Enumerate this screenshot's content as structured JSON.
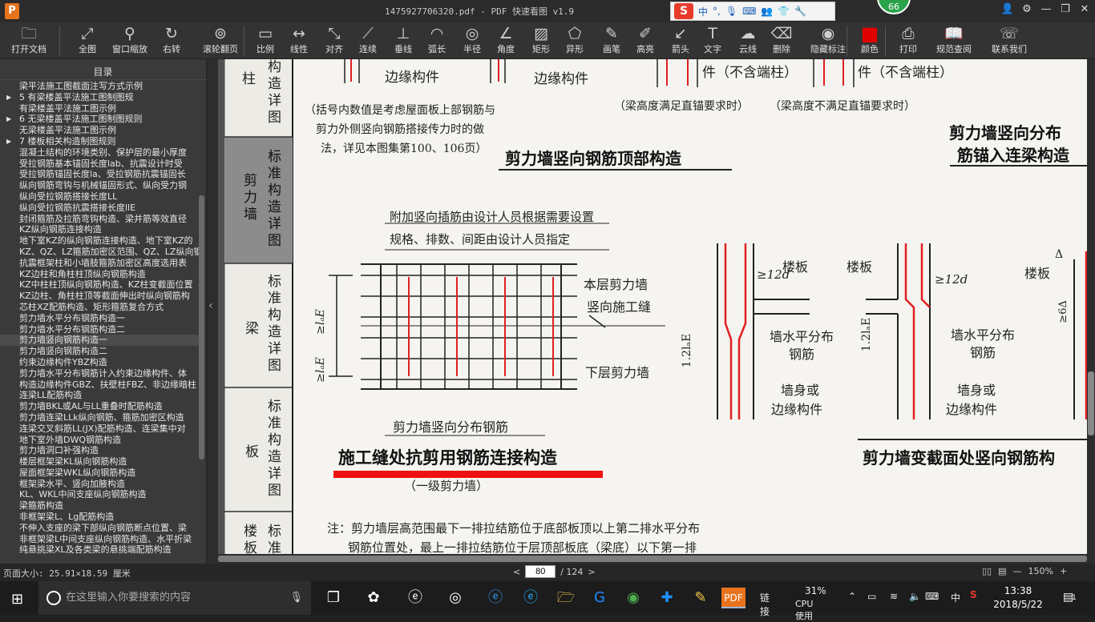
{
  "title_bar": {
    "app_logo": "P",
    "window_title": "1475927706320.pdf - PDF 快速看图 v1.9",
    "badge": "66",
    "ime": {
      "logo": "S",
      "lang": "中",
      "punct": "°,"
    },
    "buttons": {
      "user": "👤",
      "settings": "⚙",
      "min": "—",
      "max": "❐",
      "close": "✕"
    }
  },
  "toolbar": {
    "items": [
      {
        "label": "打开文档",
        "icon": "folder-icon",
        "glyph": "🗀"
      },
      {
        "label": "全图",
        "icon": "fit-all-icon",
        "glyph": "⤢"
      },
      {
        "label": "窗口缩放",
        "icon": "zoom-window-icon",
        "glyph": "⚲"
      },
      {
        "label": "右转",
        "icon": "rotate-right-icon",
        "glyph": "↻"
      },
      {
        "label": "滚轮翻页",
        "icon": "mouse-scroll-icon",
        "glyph": "⊚"
      },
      {
        "label": "比例",
        "icon": "scale-icon",
        "glyph": "▭"
      },
      {
        "label": "线性",
        "icon": "linear-measure-icon",
        "glyph": "↔"
      },
      {
        "label": "对齐",
        "icon": "aligned-measure-icon",
        "glyph": "⤡"
      },
      {
        "label": "连续",
        "icon": "continuous-measure-icon",
        "glyph": "⟋"
      },
      {
        "label": "垂线",
        "icon": "perpendicular-icon",
        "glyph": "⊥"
      },
      {
        "label": "弧长",
        "icon": "arc-length-icon",
        "glyph": "◠"
      },
      {
        "label": "半径",
        "icon": "radius-icon",
        "glyph": "◎"
      },
      {
        "label": "角度",
        "icon": "angle-icon",
        "glyph": "∠"
      },
      {
        "label": "矩形",
        "icon": "rectangle-area-icon",
        "glyph": "▨"
      },
      {
        "label": "异形",
        "icon": "polygon-area-icon",
        "glyph": "⬠"
      },
      {
        "label": "画笔",
        "icon": "pen-icon",
        "glyph": "✎"
      },
      {
        "label": "高亮",
        "icon": "highlighter-icon",
        "glyph": "✐"
      },
      {
        "label": "箭头",
        "icon": "arrow-icon",
        "glyph": "↙"
      },
      {
        "label": "文字",
        "icon": "text-icon",
        "glyph": "T"
      },
      {
        "label": "云线",
        "icon": "cloud-icon",
        "glyph": "☁"
      },
      {
        "label": "删除",
        "icon": "eraser-icon",
        "glyph": "⌫"
      },
      {
        "label": "隐藏标注",
        "icon": "hide-annotation-icon",
        "glyph": "◉"
      },
      {
        "label": "颜色",
        "icon": "color-swatch-icon",
        "glyph": "■"
      },
      {
        "label": "打印",
        "icon": "printer-icon",
        "glyph": "⎙"
      },
      {
        "label": "规范查阅",
        "icon": "book-icon",
        "glyph": "📖"
      },
      {
        "label": "联系我们",
        "icon": "headset-icon",
        "glyph": "☏"
      }
    ],
    "color_swatch": "#e00000"
  },
  "sidebar": {
    "title": "目录",
    "collapse_glyph": "‹",
    "items": [
      {
        "t": "梁平法施工图截面注写方式示例",
        "lvl": 2
      },
      {
        "t": "5 有梁楼盖平法施工图制图规",
        "lvl": 1
      },
      {
        "t": "有梁楼盖平法施工图示例",
        "lvl": 2
      },
      {
        "t": "6 无梁楼盖平法施工图制图规则",
        "lvl": 1
      },
      {
        "t": "无梁楼盖平法施工图示例",
        "lvl": 2
      },
      {
        "t": "7 楼板相关构造制图规则",
        "lvl": 1
      },
      {
        "t": "混凝土结构的环境类别、保护层的最小厚度",
        "lvl": 2
      },
      {
        "t": "受拉钢筋基本锚固长度lab、抗震设计时受",
        "lvl": 2
      },
      {
        "t": "受拉钢筋锚固长度la、受拉钢筋抗震锚固长",
        "lvl": 2
      },
      {
        "t": "纵向钢筋弯钩与机械锚固形式、纵向受力钢",
        "lvl": 2
      },
      {
        "t": "纵向受拉钢筋搭接长度LL",
        "lvl": 2
      },
      {
        "t": "纵向受拉钢筋抗震搭接长度llE",
        "lvl": 2
      },
      {
        "t": "封闭箍筋及拉筋弯钩构造、梁并筋等效直径",
        "lvl": 2
      },
      {
        "t": "KZ纵向钢筋连接构造",
        "lvl": 2
      },
      {
        "t": "地下室KZ的纵向钢筋连接构造、地下室KZ的",
        "lvl": 2
      },
      {
        "t": "KZ、QZ、LZ箍筋加密区范围、QZ、LZ纵向钢",
        "lvl": 2
      },
      {
        "t": "抗震框架柱和小墙肢箍筋加密区高度选用表",
        "lvl": 2
      },
      {
        "t": "KZ边柱和角柱柱顶纵向钢筋构造",
        "lvl": 2
      },
      {
        "t": "KZ中柱柱顶纵向钢筋构造、KZ柱变截面位置",
        "lvl": 2
      },
      {
        "t": "KZ边柱、角柱柱顶等截面伸出时纵向钢筋构",
        "lvl": 2
      },
      {
        "t": "芯柱XZ配筋构造、矩形箍筋复合方式",
        "lvl": 2
      },
      {
        "t": "剪力墙水平分布钢筋构造一",
        "lvl": 2
      },
      {
        "t": "剪力墙水平分布钢筋构造二",
        "lvl": 2
      },
      {
        "t": "剪力墙竖向钢筋构造一",
        "lvl": 2,
        "sel": true
      },
      {
        "t": "剪力墙竖向钢筋构造二",
        "lvl": 2
      },
      {
        "t": "约束边缘构件YBZ构造",
        "lvl": 2
      },
      {
        "t": "剪力墙水平分布钢筋计入约束边缘构件、体",
        "lvl": 2
      },
      {
        "t": "构造边缘构件GBZ、扶壁柱FBZ、非边缘暗柱",
        "lvl": 2
      },
      {
        "t": "连梁LL配筋构造",
        "lvl": 2
      },
      {
        "t": "剪力墙BKL或AL与LL重叠时配筋构造",
        "lvl": 2
      },
      {
        "t": "剪力墙连梁LLk纵向钢筋、箍筋加密区构造",
        "lvl": 2
      },
      {
        "t": "连梁交叉斜筋LL(JX)配筋构造、连梁集中对",
        "lvl": 2
      },
      {
        "t": "地下室外墙DWQ钢筋构造",
        "lvl": 2
      },
      {
        "t": "剪力墙洞口补强构造",
        "lvl": 2
      },
      {
        "t": "楼层框架梁KL纵向钢筋构造",
        "lvl": 2
      },
      {
        "t": "屋面框架梁WKL纵向钢筋构造",
        "lvl": 2
      },
      {
        "t": "框架梁水平、竖向加腋构造",
        "lvl": 2
      },
      {
        "t": "KL、WKL中间支座纵向钢筋构造",
        "lvl": 2
      },
      {
        "t": "梁箍筋构造",
        "lvl": 2
      },
      {
        "t": "非框架梁L、Lg配筋构造",
        "lvl": 2
      },
      {
        "t": "不伸入支座的梁下部纵向钢筋断点位置、梁",
        "lvl": 2
      },
      {
        "t": "非框架梁L中间支座纵向钢筋构造、水平折梁",
        "lvl": 2
      },
      {
        "t": "纯悬挑梁XL及各类梁的悬挑端配筋构造",
        "lvl": 2
      }
    ]
  },
  "document": {
    "tabs": [
      {
        "t": "柱",
        "sub": "构造详图"
      },
      {
        "t": "剪力墙",
        "sub": "标准构造详图"
      },
      {
        "t": "梁",
        "sub": "标准构造详图"
      },
      {
        "t": "板",
        "sub": "标准构造详图"
      },
      {
        "t": "楼板",
        "sub": "标准"
      }
    ],
    "top": {
      "edge1": "边缘构件",
      "edge2": "边缘构件",
      "non_end1": "件（不含端柱）",
      "non_end2": "件（不含端柱）",
      "anchor1": "（梁高度满足直锚要求时）",
      "anchor2": "（梁高度不满足直锚要求时）",
      "paren_note": [
        "（括号内数值是考虑屋面板上部钢筋与",
        "剪力外侧竖向钢筋搭接传力时的做",
        "法，详见本图集第100、106页）"
      ],
      "title_top": "剪力墙竖向钢筋顶部构造",
      "title_right": [
        "剪力墙竖向分布",
        "筋锚入连梁构造"
      ]
    },
    "middle": {
      "note1": "附加竖向插筋由设计人员根据需要设置",
      "note2": "规格、排数、间距由设计人员指定",
      "this_wall": "本层剪力墙",
      "const_joint": "竖向施工缝",
      "lower_wall": "下层剪力墙",
      "dist_bars": "剪力墙竖向分布钢筋",
      "lae1": "≥lₐE",
      "lae2": "≥lₐE",
      "title_main": "施工缝处抗剪用钢筋连接构造",
      "sub_main": "（一级剪力墙）",
      "floor1": "楼板",
      "floor2": "楼板",
      "floor3": "楼板",
      "d12a": "≥12d",
      "d12b": "≥12d",
      "lae12a": "1.2lₐE",
      "lae12b": "1.2lₐE",
      "horiz1": [
        "墙水平分布",
        "钢筋"
      ],
      "horiz2": [
        "墙水平分布",
        "钢筋"
      ],
      "body1": [
        "墙身或",
        "边缘构件"
      ],
      "body2": [
        "墙身或",
        "边缘构件"
      ],
      "delta": "Δ",
      "ge6": "≥6Δ",
      "title_var": "剪力墙变截面处竖向钢筋构"
    },
    "note": [
      "注：剪力墙层高范围最下一排拉结筋位于底部板顶以上第二排水平分布",
      "钢筋位置处，最上一排拉结筋位于层顶部板底（梁底）以下第一排"
    ]
  },
  "status": {
    "page_size": "页面大小: 25.91×18.59 厘米",
    "page_current": "80",
    "page_total": "/ 124",
    "zoom": "150%",
    "minus": "—",
    "plus": "+",
    "prev": "<",
    "next": ">"
  },
  "taskbar": {
    "search_placeholder": "在这里输入你要搜索的内容",
    "link": "链接",
    "cpu": "31%",
    "cpu_label": "CPU使用",
    "lang": "中",
    "time": "13:38",
    "date": "2018/5/22",
    "notif": "1"
  }
}
